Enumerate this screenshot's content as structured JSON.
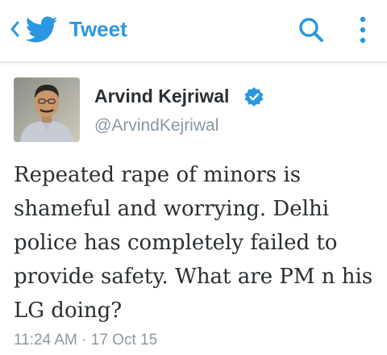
{
  "header": {
    "title": "Tweet",
    "back_icon": "chevron-left-icon",
    "logo_icon": "twitter-bird-icon",
    "search_icon": "search-icon",
    "more_icon": "more-vertical-icon",
    "accent_color": "#2b97e1"
  },
  "tweet": {
    "author_name": "Arvind Kejriwal",
    "author_handle": "@ArvindKejriwal",
    "verified": true,
    "text": "Repeated rape of minors is shameful and worrying. Delhi police has completely failed to provide safety. What are PM n his LG doing?",
    "timestamp": "11:24 AM · 17 Oct 15"
  }
}
